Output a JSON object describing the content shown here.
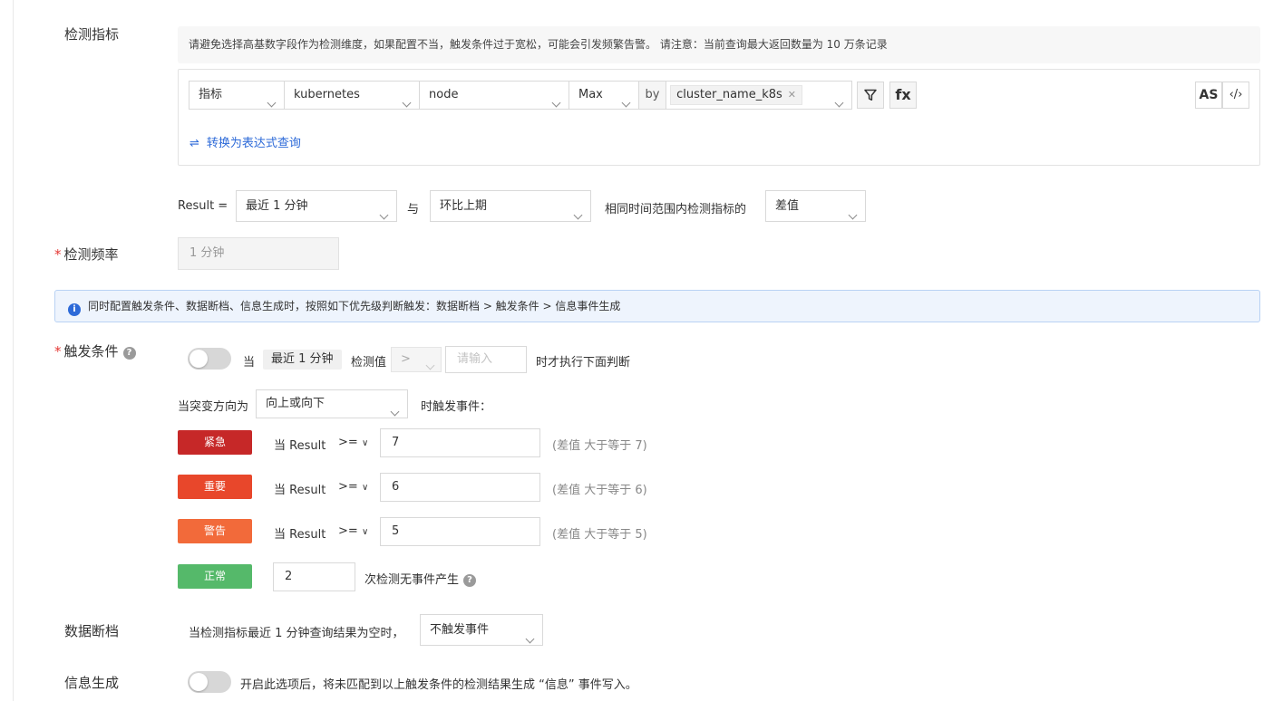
{
  "labels": {
    "metric": "检测指标",
    "frequency": "检测频率",
    "trigger": "触发条件",
    "data_gap": "数据断档",
    "info_gen": "信息生成"
  },
  "hint": "请避免选择高基数字段作为检测维度，如果配置不当，触发条件过于宽松，可能会引发频繁告警。 请注意：当前查询最大返回数量为 10 万条记录",
  "query": {
    "type": "指标",
    "source": "kubernetes",
    "measurement": "node",
    "agg": "Max",
    "by_label": "by",
    "by_tag": "cluster_name_k8s",
    "filter_icon": "filter-icon",
    "fx_label": "fx",
    "as_label": "AS",
    "code_label": "‹/›",
    "convert_link": "转换为表达式查询"
  },
  "result": {
    "label": "Result =",
    "range": "最近 1 分钟",
    "conj": "与",
    "compare": "环比上期",
    "desc": "相同时间范围内检测指标的",
    "mode": "差值"
  },
  "frequency": {
    "value": "1 分钟"
  },
  "alert": "同时配置触发条件、数据断档、信息生成时，按照如下优先级判断触发：数据断档 > 触发条件 > 信息事件生成",
  "trigger": {
    "when": "当",
    "range_chip": "最近 1 分钟",
    "check_value": "检测值",
    "op": ">",
    "input_placeholder": "请输入",
    "then_text": "时才执行下面判断",
    "direction_label": "当突变方向为",
    "direction": "向上或向下",
    "direction_suffix": "时触发事件：",
    "levels": [
      {
        "name": "紧急",
        "color": "#c62828",
        "when": "当 Result",
        "op": ">=",
        "value": "7",
        "note": "(差值 大于等于 7)"
      },
      {
        "name": "重要",
        "color": "#e8472b",
        "when": "当 Result",
        "op": ">=",
        "value": "6",
        "note": "(差值 大于等于 6)"
      },
      {
        "name": "警告",
        "color": "#f26a3a",
        "when": "当 Result",
        "op": ">=",
        "value": "5",
        "note": "(差值 大于等于 5)"
      }
    ],
    "normal": {
      "name": "正常",
      "color": "#55b96a",
      "value": "2",
      "text": "次检测无事件产生"
    }
  },
  "data_gap": {
    "text": "当检测指标最近 1 分钟查询结果为空时，",
    "option": "不触发事件"
  },
  "info_gen": {
    "text": "开启此选项后，将未匹配到以上触发条件的检测结果生成 “信息” 事件写入。"
  }
}
